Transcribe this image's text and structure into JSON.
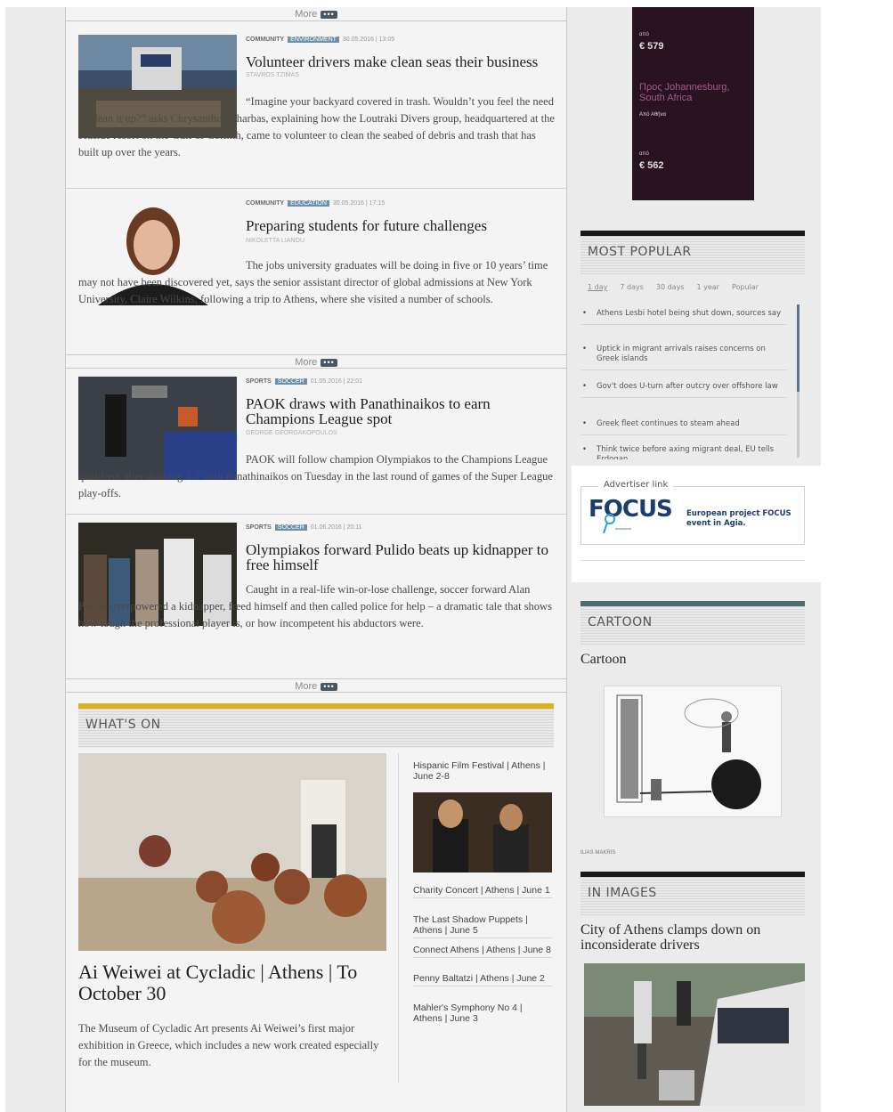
{
  "more_label": "More",
  "more_dots": "•••",
  "articles": [
    {
      "section": "COMMUNITY",
      "tag": "ENVIRONMENT",
      "date": "30.05.2016 | 13:05",
      "headline": "Volunteer drivers make clean seas their business",
      "byline": "STAVROS TZIMAS",
      "summary": "“Imagine your backyard covered in trash. Wouldn’t you feel the need to clean it up?” asks Chrysanthos Charbas, explaining how the Loutraki Divers group, headquartered at the seaside resort on the Gulf of Corinth, came to volunteer to clean the seabed of debris and trash that has built up over the years."
    },
    {
      "section": "COMMUNITY",
      "tag": "EDUCATION",
      "date": "30.05.2016 | 17:15",
      "headline": "Preparing students for future challenges",
      "byline": "NIKOLETTA LIANOU",
      "summary": "The jobs university graduates will be doing in five or 10 years’ time may not have been discovered yet, says the senior assistant director of global admissions at New York University, Claire Wilkins, following a trip to Athens, where she visited a number of schools."
    },
    {
      "section": "SPORTS",
      "tag": "SOCCER",
      "date": "01.05.2016 | 22:01",
      "headline": "PAOK draws with Panathinaikos to earn Champions League spot",
      "byline": "GEORGE GEORGAKOPOULOS",
      "summary": "PAOK will follow champion Olympiakos to the Champions League qualifiers after drawing 1-1 with Panathinaikos on Tuesday in the last round of games of the Super League play-offs."
    },
    {
      "section": "SPORTS",
      "tag": "SOCCER",
      "date": "01.06.2016 | 20:11",
      "headline": "Olympiakos forward Pulido beats up kidnapper to free himself",
      "byline": "",
      "summary": "Caught in a real-life win-or-lose challenge, soccer forward Alan Pulido overpowered a kidnapper, freed himself and then called police for help – a dramatic tale that shows how tough the professional player is, or how incompetent his abductors were."
    }
  ],
  "whats_on": {
    "title": "WHAT'S ON",
    "main_headline": "Ai Weiwei at Cycladic | Athens | To October 30",
    "main_summary": "The Museum of Cycladic Art presents Ai Weiwei’s first major exhibition in Greece, which includes a new work created especially for the museum.",
    "items": [
      "Hispanic Film Festival | Athens | June 2-8",
      "Charity Concert | Athens | June 1",
      "The Last Shadow Puppets | Athens | June 5",
      "Connect Athens | Athens | June 8",
      "Penny Baltatzi | Athens | June 2",
      "Mahler's Symphony No 4 | Athens | June 3"
    ]
  },
  "sidebar": {
    "ad": {
      "from1": "από",
      "price1": "€ 579",
      "dest": "Προς Johannesburg, South Africa",
      "origin": "Από Αθήνα",
      "from2": "από",
      "price2": "€ 562"
    },
    "most_popular": {
      "title": "MOST POPULAR",
      "tabs": [
        "1 day",
        "7 days",
        "30 days",
        "1 year",
        "Popular"
      ],
      "items": [
        "Athens Lesbi hotel being shut down, sources say",
        "Uptick in migrant arrivals raises concerns on Greek islands",
        "Gov't does U-turn after outcry over offshore law",
        "Greek fleet continues to steam ahead",
        "Think twice before axing migrant deal, EU tells Erdogan"
      ]
    },
    "advertiser": {
      "label": "Advertiser link",
      "logo": "FOCUS",
      "text": "European project FOCUS event in Agia."
    },
    "cartoon": {
      "title": "CARTOON",
      "heading": "Cartoon",
      "credit": "ILIAS MAKRIS"
    },
    "in_images": {
      "title": "IN IMAGES",
      "headline": "City of Athens clamps down on inconsiderate drivers"
    }
  },
  "colors": {
    "accent_yellow": "#d9b21f",
    "heading_bar": "#1a1a1a",
    "teal_bar": "#4f6a70",
    "tag_blue": "#6d8fa8",
    "ad_dark": "#2a1320"
  }
}
